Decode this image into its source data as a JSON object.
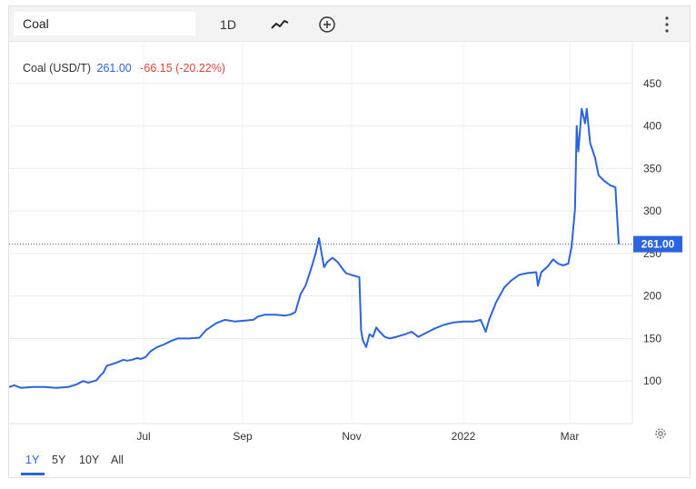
{
  "toolbar": {
    "symbol_value": "Coal",
    "interval_label": "1D",
    "chart_type_icon": "line-chart-icon",
    "compare_icon": "add-circle-icon",
    "more_icon": "vertical-dots-icon"
  },
  "legend": {
    "name": "Coal (USD/T)",
    "price": "261.00",
    "change": "-66.15 (-20.22%)"
  },
  "last_price_label": "261.00",
  "range_buttons": [
    "1Y",
    "5Y",
    "10Y",
    "All"
  ],
  "active_range": "1Y",
  "settings_icon": "gear-icon",
  "colors": {
    "line": "#2b63e0",
    "negative": "#e0443a",
    "price_tag": "#2b63e0"
  },
  "chart_data": {
    "type": "line",
    "title": "Coal (USD/T)",
    "xlabel": "",
    "ylabel": "",
    "ylim": [
      50,
      500
    ],
    "y_ticks": [
      100,
      150,
      200,
      250,
      300,
      350,
      400,
      450
    ],
    "x_ticks": [
      "Jul",
      "Sep",
      "Nov",
      "2022",
      "Mar"
    ],
    "x_range": [
      "2021-04-23",
      "2022-03-24"
    ],
    "grid": true,
    "series": [
      {
        "values": [
          [
            "2021-04-23",
            93
          ],
          [
            "2021-04-26",
            95
          ],
          [
            "2021-04-30",
            92
          ],
          [
            "2021-05-07",
            93
          ],
          [
            "2021-05-14",
            93
          ],
          [
            "2021-05-21",
            92
          ],
          [
            "2021-05-28",
            93
          ],
          [
            "2021-06-02",
            96
          ],
          [
            "2021-06-06",
            100
          ],
          [
            "2021-06-09",
            98
          ],
          [
            "2021-06-14",
            101
          ],
          [
            "2021-06-16",
            106
          ],
          [
            "2021-06-18",
            110
          ],
          [
            "2021-06-20",
            118
          ],
          [
            "2021-06-25",
            121
          ],
          [
            "2021-06-30",
            125
          ],
          [
            "2021-07-02",
            124
          ],
          [
            "2021-07-05",
            125
          ],
          [
            "2021-07-08",
            127
          ],
          [
            "2021-07-10",
            126
          ],
          [
            "2021-07-13",
            128
          ],
          [
            "2021-07-16",
            135
          ],
          [
            "2021-07-20",
            140
          ],
          [
            "2021-07-24",
            143
          ],
          [
            "2021-07-28",
            147
          ],
          [
            "2021-08-01",
            150
          ],
          [
            "2021-08-08",
            150
          ],
          [
            "2021-08-14",
            151
          ],
          [
            "2021-08-18",
            160
          ],
          [
            "2021-08-24",
            168
          ],
          [
            "2021-08-29",
            172
          ],
          [
            "2021-09-04",
            170
          ],
          [
            "2021-09-10",
            171
          ],
          [
            "2021-09-15",
            172
          ],
          [
            "2021-09-18",
            176
          ],
          [
            "2021-09-22",
            178
          ],
          [
            "2021-09-28",
            178
          ],
          [
            "2021-10-04",
            177
          ],
          [
            "2021-10-07",
            178
          ],
          [
            "2021-10-10",
            181
          ],
          [
            "2021-10-13",
            202
          ],
          [
            "2021-10-16",
            212
          ],
          [
            "2021-10-19",
            230
          ],
          [
            "2021-10-22",
            250
          ],
          [
            "2021-10-24",
            268
          ],
          [
            "2021-10-26",
            245
          ],
          [
            "2021-10-27",
            234
          ],
          [
            "2021-10-29",
            240
          ],
          [
            "2021-11-01",
            245
          ],
          [
            "2021-11-04",
            240
          ],
          [
            "2021-11-07",
            232
          ],
          [
            "2021-11-09",
            227
          ],
          [
            "2021-11-12",
            225
          ],
          [
            "2021-11-17",
            222
          ],
          [
            "2021-11-18",
            160
          ],
          [
            "2021-11-19",
            148
          ],
          [
            "2021-11-21",
            140
          ],
          [
            "2021-11-23",
            155
          ],
          [
            "2021-11-25",
            152
          ],
          [
            "2021-11-27",
            163
          ],
          [
            "2021-11-29",
            158
          ],
          [
            "2021-12-02",
            152
          ],
          [
            "2021-12-05",
            150
          ],
          [
            "2021-12-09",
            152
          ],
          [
            "2021-12-14",
            155
          ],
          [
            "2021-12-18",
            158
          ],
          [
            "2021-12-22",
            152
          ],
          [
            "2021-12-27",
            157
          ],
          [
            "2022-01-01",
            162
          ],
          [
            "2022-01-06",
            166
          ],
          [
            "2022-01-12",
            169
          ],
          [
            "2022-01-18",
            170
          ],
          [
            "2022-01-24",
            170
          ],
          [
            "2022-01-28",
            172
          ],
          [
            "2022-01-31",
            158
          ],
          [
            "2022-02-02",
            172
          ],
          [
            "2022-02-06",
            192
          ],
          [
            "2022-02-11",
            210
          ],
          [
            "2022-02-15",
            218
          ],
          [
            "2022-02-20",
            225
          ],
          [
            "2022-02-25",
            227
          ],
          [
            "2022-03-02",
            228
          ],
          [
            "2022-03-03",
            212
          ],
          [
            "2022-03-05",
            228
          ],
          [
            "2022-03-09",
            235
          ],
          [
            "2022-03-12",
            243
          ],
          [
            "2022-03-15",
            238
          ],
          [
            "2022-03-18",
            236
          ],
          [
            "2022-03-21",
            238
          ],
          [
            "2022-03-23",
            258
          ],
          [
            "2022-03-25",
            302
          ],
          [
            "2022-03-26",
            400
          ],
          [
            "2022-03-27",
            370
          ],
          [
            "2022-03-29",
            420
          ],
          [
            "2022-03-31",
            403
          ],
          [
            "2022-04-01",
            420
          ],
          [
            "2022-04-03",
            380
          ],
          [
            "2022-04-06",
            362
          ],
          [
            "2022-04-08",
            342
          ],
          [
            "2022-04-11",
            336
          ],
          [
            "2022-04-15",
            330
          ],
          [
            "2022-04-18",
            328
          ],
          [
            "2022-04-20",
            261
          ]
        ]
      }
    ]
  }
}
